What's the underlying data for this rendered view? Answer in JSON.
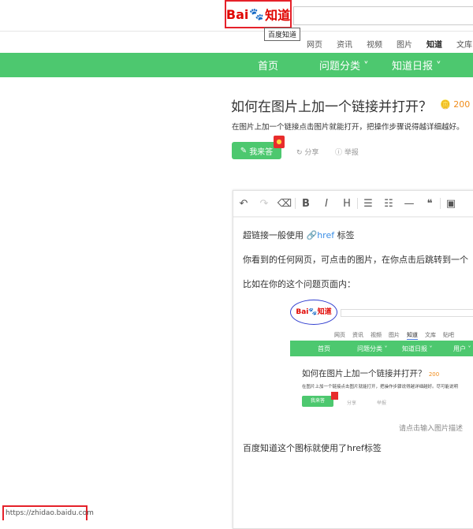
{
  "header": {
    "logo_text": "Bai",
    "logo_paw": "du",
    "logo_cn": "知道",
    "tooltip": "百度知道",
    "tabs": [
      {
        "label": "网页"
      },
      {
        "label": "资讯"
      },
      {
        "label": "视频"
      },
      {
        "label": "图片"
      },
      {
        "label": "知道",
        "active": true
      },
      {
        "label": "文库"
      }
    ]
  },
  "nav": {
    "items": [
      "首页",
      "问题分类 ˅",
      "知道日报 ˅"
    ]
  },
  "question": {
    "title": "如何在图片上加一个链接并打开？",
    "reward": "200",
    "description": "在图片上加一个链接点击图片就能打开，把操作步骤说得越详细越好。",
    "answer_label": "我来答",
    "share_label": "分享",
    "report_label": "举报"
  },
  "editor": {
    "toolbar": [
      "↶",
      "↷",
      "⌫",
      "B",
      "I",
      "H",
      "☰",
      "☷",
      "—",
      "❝",
      "▣"
    ],
    "lines": [
      "超链接一般使用",
      "href",
      "标签",
      "你看到的任何网页，可点击的图片，在你点击后跳转到一个",
      "比如在你的这个问题页面内：",
      "百度知道这个图标就使用了href标签"
    ],
    "image": {
      "tabs": [
        "网页",
        "资讯",
        "视频",
        "图片",
        "知道",
        "文库",
        "贴吧"
      ],
      "nav": [
        "首页",
        "问题分类 ˅",
        "知道日报 ˅",
        "用户 ˅"
      ],
      "title": "如何在图片上加一个链接并打开？",
      "reward": "200",
      "description": "在图片上加一个链接点击图片就能打开，把操作步骤说得越详细越好。尽可能说明",
      "answer_label": "我来答",
      "share_label": "分享",
      "report_label": "举报"
    },
    "caption": "请点击输入图片描述"
  },
  "status_url": "https://zhidao.baidu.com",
  "colors": {
    "green": "#4dc86f",
    "red": "#e5212a",
    "blue": "#2932e1"
  }
}
